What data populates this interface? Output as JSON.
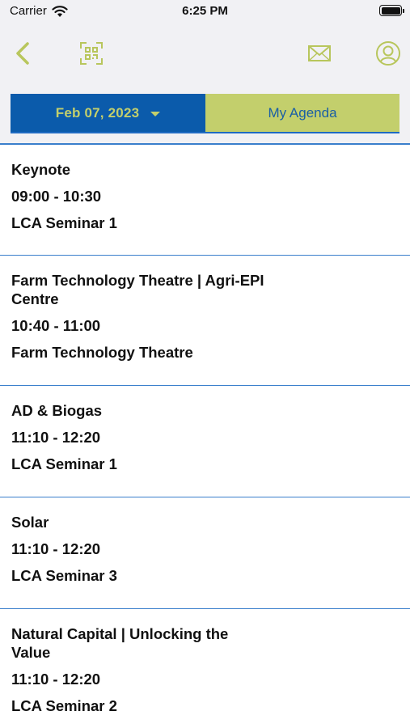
{
  "status_bar": {
    "carrier": "Carrier",
    "time": "6:25 PM"
  },
  "nav": {
    "back_icon": "chevron-left-icon",
    "scan_icon": "qr-scan-icon",
    "mail_icon": "envelope-icon",
    "profile_icon": "user-circle-icon"
  },
  "colors": {
    "accent_blue": "#0b5bab",
    "accent_green": "#c3cf6c",
    "divider": "#3a7fcc"
  },
  "segment": {
    "date_label": "Feb 07, 2023",
    "agenda_label": "My Agenda"
  },
  "sessions": [
    {
      "title": "Keynote",
      "time": "09:00 - 10:30",
      "room": "LCA Seminar 1"
    },
    {
      "title": "Farm Technology Theatre | Agri-EPI Centre",
      "time": "10:40 - 11:00",
      "room": "Farm Technology Theatre"
    },
    {
      "title": "AD & Biogas",
      "time": "11:10 - 12:20",
      "room": "LCA Seminar 1"
    },
    {
      "title": "Solar",
      "time": "11:10 - 12:20",
      "room": "LCA Seminar 3"
    },
    {
      "title": "Natural Capital | Unlocking the Value",
      "time": "11:10 - 12:20",
      "room": "LCA Seminar 2"
    }
  ]
}
